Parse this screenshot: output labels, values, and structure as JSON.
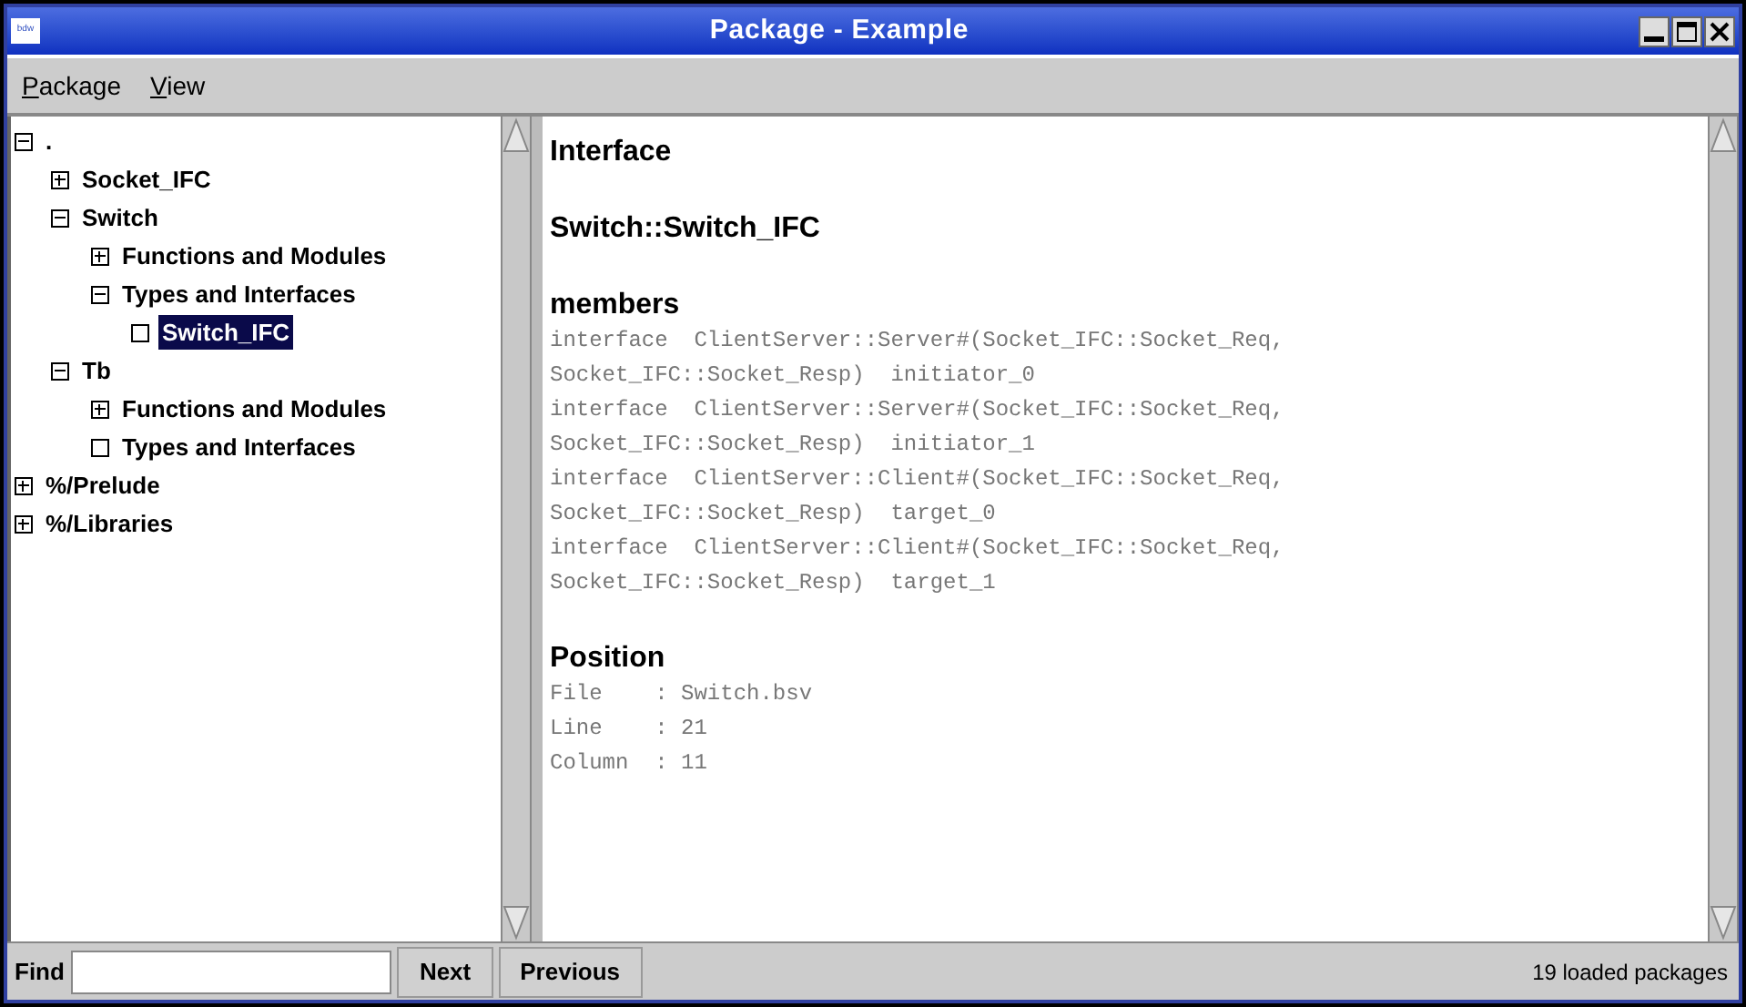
{
  "window": {
    "title": "Package - Example",
    "app_icon": "bdw"
  },
  "menu": [
    "Package",
    "View"
  ],
  "tree": [
    {
      "label": ".",
      "kind": "open",
      "selected": false,
      "children": [
        {
          "label": "Socket_IFC",
          "kind": "closed",
          "selected": false
        },
        {
          "label": "Switch",
          "kind": "open",
          "selected": false,
          "children": [
            {
              "label": "Functions and Modules",
              "kind": "closed",
              "selected": false
            },
            {
              "label": "Types and Interfaces",
              "kind": "open",
              "selected": false,
              "children": [
                {
                  "label": "Switch_IFC",
                  "kind": "leaf",
                  "selected": true
                }
              ]
            }
          ]
        },
        {
          "label": "Tb",
          "kind": "open",
          "selected": false,
          "children": [
            {
              "label": "Functions and Modules",
              "kind": "closed",
              "selected": false
            },
            {
              "label": "Types and Interfaces",
              "kind": "leaf",
              "selected": false
            }
          ]
        }
      ]
    },
    {
      "label": "%/Prelude",
      "kind": "closed",
      "selected": false
    },
    {
      "label": "%/Libraries",
      "kind": "closed",
      "selected": false
    }
  ],
  "sections": [
    {
      "heading": "Interface"
    },
    {
      "heading": "Switch::Switch_IFC"
    },
    {
      "heading": "members",
      "lines": [
        "interface  ClientServer::Server#(Socket_IFC::Socket_Req,",
        "Socket_IFC::Socket_Resp)  initiator_0",
        "interface  ClientServer::Server#(Socket_IFC::Socket_Req,",
        "Socket_IFC::Socket_Resp)  initiator_1",
        "interface  ClientServer::Client#(Socket_IFC::Socket_Req,",
        "Socket_IFC::Socket_Resp)  target_0",
        "interface  ClientServer::Client#(Socket_IFC::Socket_Req,",
        "Socket_IFC::Socket_Resp)  target_1"
      ]
    },
    {
      "heading": "Position",
      "lines": [
        "File    : Switch.bsv",
        "Line    : 21",
        "Column  : 11"
      ]
    }
  ],
  "find": {
    "label": "Find",
    "buttons": [
      "Next",
      "Previous"
    ]
  },
  "status": "19 loaded packages"
}
